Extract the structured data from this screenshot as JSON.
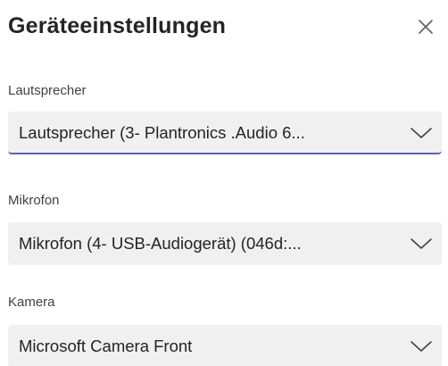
{
  "dialog": {
    "title": "Geräteeinstellungen",
    "close_icon": "close-icon"
  },
  "speaker": {
    "label": "Lautsprecher",
    "value": "Lautsprecher (3- Plantronics .Audio 6...",
    "icon": "chevron-down-icon"
  },
  "microphone": {
    "label": "Mikrofon",
    "value": "Mikrofon (4- USB-Audiogerät) (046d:...",
    "icon": "chevron-down-icon"
  },
  "camera": {
    "label": "Kamera",
    "value": "Microsoft Camera Front",
    "icon": "chevron-down-icon"
  },
  "colors": {
    "accent": "#5b5fc7",
    "field_bg": "#f0f0f0",
    "text": "#242424"
  }
}
